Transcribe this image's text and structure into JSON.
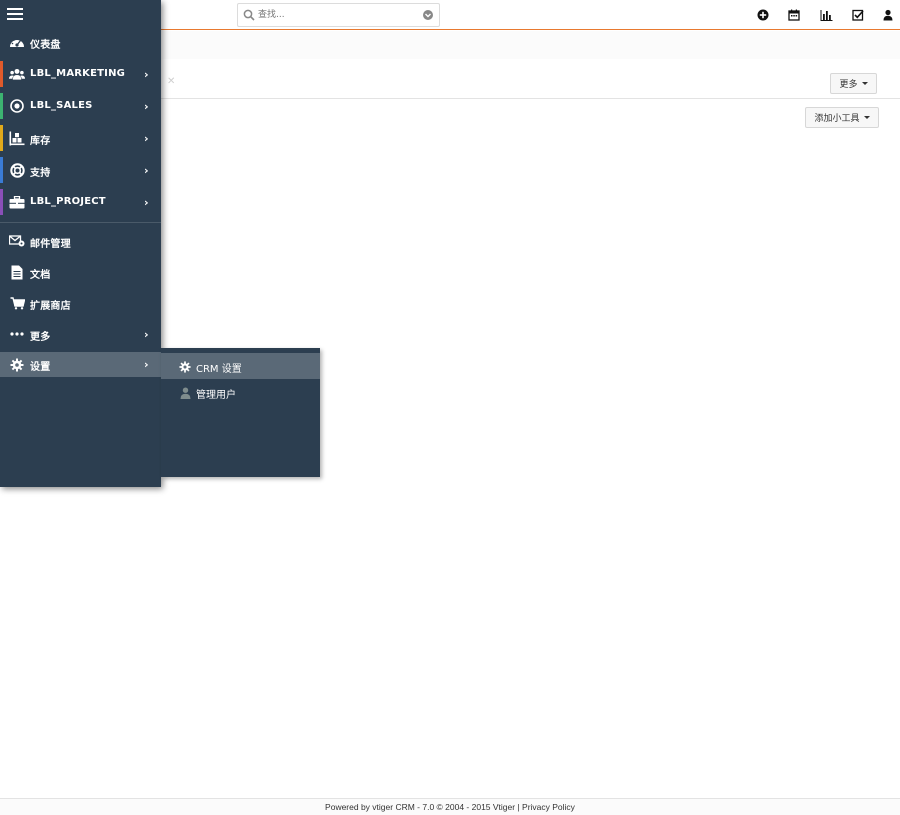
{
  "search": {
    "placeholder": "查找..."
  },
  "toolbar": {
    "icons": [
      "plus-circle-icon",
      "calendar-icon",
      "bar-chart-icon",
      "task-check-icon",
      "user-icon"
    ]
  },
  "page": {
    "more_button": "更多",
    "add_widget_button": "添加小工具"
  },
  "sidebar": {
    "items": [
      {
        "label": "仪表盘",
        "icon": "dashboard-icon"
      },
      {
        "label": "LBL_MARKETING",
        "icon": "users-icon",
        "color": "#e05a2b"
      },
      {
        "label": "LBL_SALES",
        "icon": "target-icon",
        "color": "#3cb371"
      },
      {
        "label": "库存",
        "icon": "inventory-icon",
        "color": "#e1a91b"
      },
      {
        "label": "支持",
        "icon": "lifebuoy-icon",
        "color": "#3a7bd5"
      },
      {
        "label": "LBL_PROJECT",
        "icon": "briefcase-icon",
        "color": "#8a4fb8"
      },
      {
        "label": "邮件管理",
        "icon": "mail-settings-icon"
      },
      {
        "label": "文档",
        "icon": "document-icon"
      },
      {
        "label": "扩展商店",
        "icon": "cart-icon"
      },
      {
        "label": "更多",
        "icon": "ellipsis-icon"
      },
      {
        "label": "设置",
        "icon": "gear-icon"
      }
    ]
  },
  "settings_submenu": {
    "items": [
      {
        "label": "CRM 设置",
        "icon": "gear-icon"
      },
      {
        "label": "管理用户",
        "icon": "user-icon"
      }
    ]
  },
  "footer": {
    "text": "Powered by vtiger CRM - 7.0  © 2004 - 2015  Vtiger  |  ",
    "privacy": "Privacy Policy"
  },
  "colors": {
    "sidebar_bg": "#2c3e50",
    "active_bg": "#5a6977",
    "accent": "#e8792f"
  }
}
